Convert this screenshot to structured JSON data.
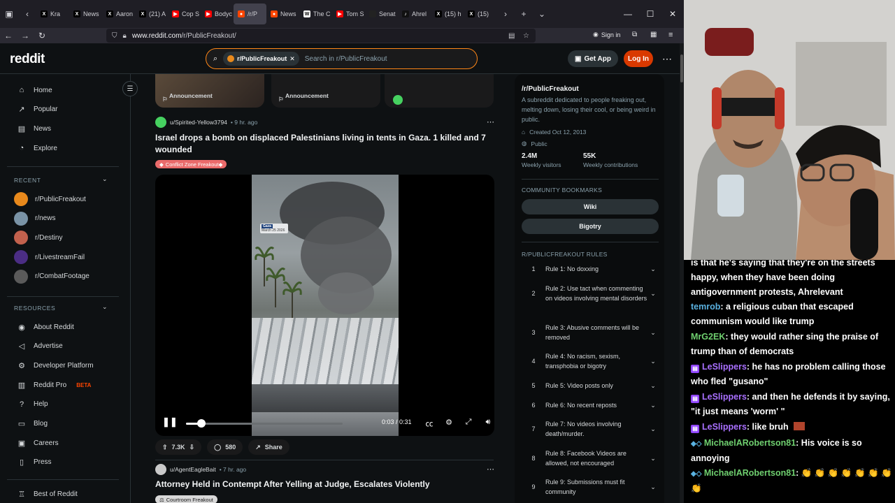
{
  "browser": {
    "tabs": [
      {
        "label": "Kra",
        "fav": "x"
      },
      {
        "label": "News",
        "fav": "x"
      },
      {
        "label": "Aaron",
        "fav": "x"
      },
      {
        "label": "(21) A",
        "fav": "x"
      },
      {
        "label": "Cop S",
        "fav": "yt"
      },
      {
        "label": "Bodyc",
        "fav": "yt"
      },
      {
        "label": "/r/P",
        "fav": "reddit"
      },
      {
        "label": "News",
        "fav": "reddit"
      },
      {
        "label": "The C",
        "fav": "w"
      },
      {
        "label": "Tom S",
        "fav": "yt"
      },
      {
        "label": "Senat",
        "fav": "dark"
      },
      {
        "label": "Ahrel",
        "fav": "tiktok"
      },
      {
        "label": "(15) h",
        "fav": "x"
      },
      {
        "label": "(15)",
        "fav": "x"
      }
    ],
    "url_host": "www.reddit.com",
    "url_path": "/r/PublicFreakout/",
    "sign_in": "Sign in"
  },
  "reddit_header": {
    "logo": "reddit",
    "search_chip": "r/PublicFreakout",
    "search_placeholder": "Search in r/PublicFreakout",
    "get_app": "Get App",
    "login": "Log In"
  },
  "leftnav": {
    "main": [
      {
        "label": "Home",
        "icon": "home-icon",
        "glyph": "⌂"
      },
      {
        "label": "Popular",
        "icon": "popular-icon",
        "glyph": "↗"
      },
      {
        "label": "News",
        "icon": "news-icon",
        "glyph": "▤"
      },
      {
        "label": "Explore",
        "icon": "explore-icon",
        "glyph": "◔"
      }
    ],
    "recent_title": "RECENT",
    "recent": [
      {
        "label": "r/PublicFreakout",
        "color": "#e8891c"
      },
      {
        "label": "r/news",
        "color": "#7a93a6"
      },
      {
        "label": "r/Destiny",
        "color": "#c2614d"
      },
      {
        "label": "r/LivestreamFail",
        "color": "#4b2d84"
      },
      {
        "label": "r/CombatFootage",
        "color": "#5a5a5a"
      }
    ],
    "resources_title": "RESOURCES",
    "resources": [
      {
        "label": "About Reddit",
        "glyph": "◉"
      },
      {
        "label": "Advertise",
        "glyph": "◁"
      },
      {
        "label": "Developer Platform",
        "glyph": "⚙"
      },
      {
        "label": "Reddit Pro",
        "glyph": "▥",
        "badge": "BETA"
      },
      {
        "label": "Help",
        "glyph": "?"
      },
      {
        "label": "Blog",
        "glyph": "▭"
      },
      {
        "label": "Careers",
        "glyph": "▣"
      },
      {
        "label": "Press",
        "glyph": "▯"
      }
    ],
    "best_of": "Best of Reddit"
  },
  "feed": {
    "announcements": [
      "Announcement",
      "Announcement"
    ],
    "post1": {
      "author": "u/Spirited-Yellow3794",
      "time": "• 9 hr. ago",
      "title": "Israel drops a bomb on displaced Palestinians living in tents in Gaza. 1 killed and 7 wounded",
      "flair": "Conflict Zone Freakout",
      "video_tag": "Gaza",
      "video_date": "March 25 2026",
      "time_display": "0:03 / 0:31",
      "progress": 0.1,
      "upvotes": "7.3K",
      "comments": "580",
      "share": "Share"
    },
    "post2": {
      "author": "u/AgentEagleBait",
      "time": "• 7 hr. ago",
      "title": "Attorney Held in Contempt After Yelling at Judge, Escalates Violently",
      "flair": "Courtroom Freakout"
    }
  },
  "sidebar": {
    "title": "/r/PublicFreakout",
    "description": "A subreddit dedicated to people freaking out, melting down, losing their cool, or being weird in public.",
    "created": "Created Oct 12, 2013",
    "visibility": "Public",
    "stats": [
      {
        "value": "2.4M",
        "label": "Weekly visitors"
      },
      {
        "value": "55K",
        "label": "Weekly contributions"
      }
    ],
    "bookmarks_title": "COMMUNITY BOOKMARKS",
    "bookmarks": [
      "Wiki",
      "Bigotry"
    ],
    "rules_title": "R/PUBLICFREAKOUT RULES",
    "rules": [
      {
        "n": "1",
        "text": "Rule 1: No doxxing"
      },
      {
        "n": "2",
        "text": "Rule 2: Use tact when commenting on videos involving mental disorders"
      },
      {
        "n": "3",
        "text": "Rule 3: Abusive comments will be removed"
      },
      {
        "n": "4",
        "text": "Rule 4: No racism, sexism, transphobia or bigotry"
      },
      {
        "n": "5",
        "text": "Rule 5: Video posts only"
      },
      {
        "n": "6",
        "text": "Rule 6: No recent reposts"
      },
      {
        "n": "7",
        "text": "Rule 7: No videos involving death/murder."
      },
      {
        "n": "8",
        "text": "Rule 8: Facebook Videos are allowed, not encouraged"
      },
      {
        "n": "9",
        "text": "Rule 9: Submissions must fit community"
      }
    ]
  },
  "chat": {
    "messages": [
      {
        "user": "",
        "text": "is that he's saying that they're on the streets happy, when they have been doing antigovernment protests, Ahrelevant"
      },
      {
        "user": "temrob",
        "text": ": a religious cuban that escaped communism would like trump",
        "color": "blue"
      },
      {
        "user": "MrG2EK",
        "text": ": they would rather sing the praise of trump than of democrats",
        "color": "green"
      },
      {
        "user": "LeSlippers",
        "text": ": he has no problem calling those who fled \"gusano\"",
        "color": "purple"
      },
      {
        "user": "LeSlippers",
        "text": ": and then he defends it by saying, \"it just means 'worm' \"",
        "color": "purple"
      },
      {
        "user": "LeSlippers",
        "text": ": like bruh",
        "color": "purple"
      },
      {
        "user": "MichaelARobertson81",
        "text": ": His voice is so annoying",
        "color": "green"
      },
      {
        "user": "MichaelARobertson81",
        "text": ": 👏 👏 👏 👏 👏 👏 👏 👏",
        "color": "green"
      }
    ]
  },
  "colors": {
    "reddit_orange": "#ff4500",
    "login_bg": "#d93900",
    "search_border": "#ff8717",
    "chat_purple": "#a970ff"
  }
}
